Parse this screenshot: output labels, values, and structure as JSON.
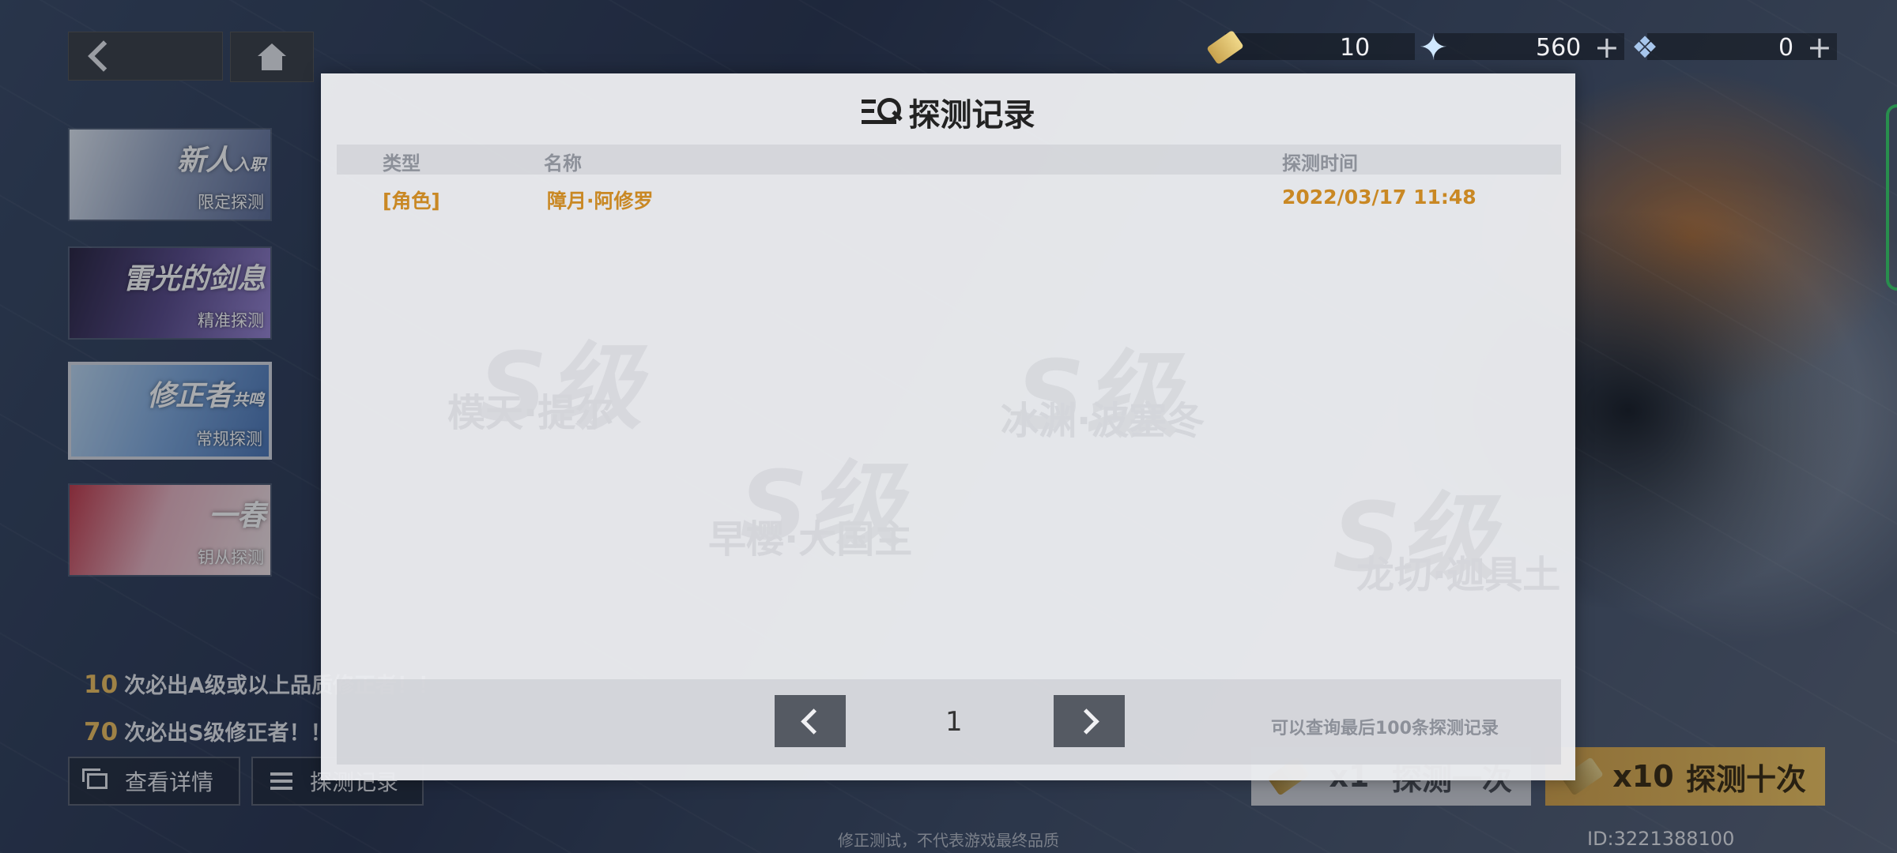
{
  "currency": [
    {
      "icon": "ticket-icon",
      "value": "10",
      "plus": ""
    },
    {
      "icon": "star-crystal-icon",
      "value": "560",
      "plus": "+"
    },
    {
      "icon": "crystal-icon",
      "value": "0",
      "plus": "+"
    }
  ],
  "banners": [
    {
      "title": "新人",
      "title_small": "入职",
      "subtitle": "限定探测"
    },
    {
      "title": "雷光的剑息",
      "title_small": "",
      "subtitle": "精准探测"
    },
    {
      "title": "修正者",
      "title_small": "共鸣",
      "subtitle": "常规探测"
    },
    {
      "title": "一春",
      "title_small": "",
      "subtitle": "钥从探测"
    }
  ],
  "pity": [
    {
      "count": "10",
      "text": "次必出A级或以上品质修正者！！"
    },
    {
      "count": "70",
      "text": "次必出S级修正者！！"
    }
  ],
  "buttons": {
    "details": "查看详情",
    "records": "探测记录",
    "pull1_count": "x1",
    "pull1_label": "探测一次",
    "pull10_count": "x10",
    "pull10_label": "探测十次"
  },
  "footer_note": "修正测试，不代表游戏最终品质",
  "uid": "ID:3221388100",
  "watermarks": [
    "S级",
    "S级",
    "S级",
    "S级",
    "模天·提尔",
    "冰渊·波塞冬",
    "早樱·大国主",
    "龙切·迦具土"
  ],
  "modal": {
    "title": "探测记录",
    "columns": {
      "type": "类型",
      "name": "名称",
      "time": "探测时间"
    },
    "rows": [
      {
        "type": "[角色]",
        "name": "障月·阿修罗",
        "time": "2022/03/17 11:48"
      }
    ],
    "page": "1",
    "note": "可以查询最后100条探测记录"
  }
}
